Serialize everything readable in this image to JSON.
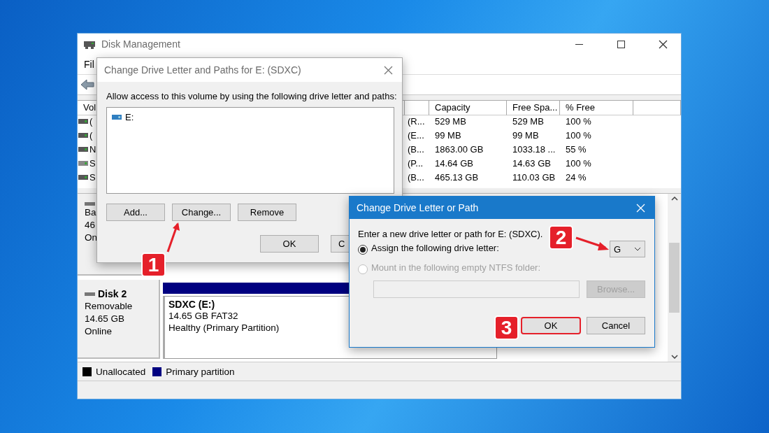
{
  "window": {
    "title": "Disk Management"
  },
  "menu": [
    "Fil"
  ],
  "volume_table": {
    "columns": [
      "Vol",
      "Capacity",
      "Free Spa...",
      "% Free"
    ],
    "rows": [
      {
        "column_1": "(",
        "column_3": "(R...",
        "capacity": "529 MB",
        "free_space": "529 MB",
        "percent_free": "100 %"
      },
      {
        "column_1": "(",
        "column_3": "(E...",
        "capacity": "99 MB",
        "free_space": "99 MB",
        "percent_free": "100 %"
      },
      {
        "column_1": "N",
        "column_3": "(B...",
        "capacity": "1863.00 GB",
        "free_space": "1033.18 ...",
        "percent_free": "55 %"
      },
      {
        "column_1": "S",
        "column_3": "(P...",
        "capacity": "14.64 GB",
        "free_space": "14.63 GB",
        "percent_free": "100 %"
      },
      {
        "column_1": "S",
        "column_3": "(B...",
        "capacity": "465.13 GB",
        "free_space": "110.03 GB",
        "percent_free": "24 %"
      }
    ]
  },
  "disks": [
    {
      "lines": [
        "Ba",
        "46",
        "On"
      ]
    },
    {
      "name": "Disk 2",
      "lines": [
        "Removable",
        "14.65 GB",
        "Online"
      ],
      "partition": {
        "name": "SDXC  (E:)",
        "lines": [
          "14.65 GB FAT32",
          "Healthy (Primary Partition)"
        ]
      }
    }
  ],
  "legend": [
    {
      "label": "Unallocated",
      "color": "#000000"
    },
    {
      "label": "Primary partition",
      "color": "#000080"
    }
  ],
  "paths_dialog": {
    "title": "Change Drive Letter and Paths for E: (SDXC)",
    "prompt": "Allow access to this volume by using the following drive letter and paths:",
    "paths": [
      "E:"
    ],
    "buttons": [
      "Add...",
      "Change...",
      "Remove"
    ],
    "ok": "OK",
    "cancel": "C"
  },
  "letter_dialog": {
    "title": "Change Drive Letter or Path",
    "prompt": "Enter a new drive letter or path for E: (SDXC).",
    "options": [
      {
        "label": "Assign the following drive letter:",
        "selected": true,
        "disabled": false
      },
      {
        "label": "Mount in the following empty NTFS folder:",
        "selected": false,
        "disabled": true
      }
    ],
    "drive_letter": "G",
    "browse": "Browse...",
    "ok": {
      "label": "OK",
      "highlighted": true
    },
    "cancel": "Cancel"
  },
  "annotations": [
    {
      "number": "1"
    },
    {
      "number": "2"
    },
    {
      "number": "3"
    }
  ]
}
